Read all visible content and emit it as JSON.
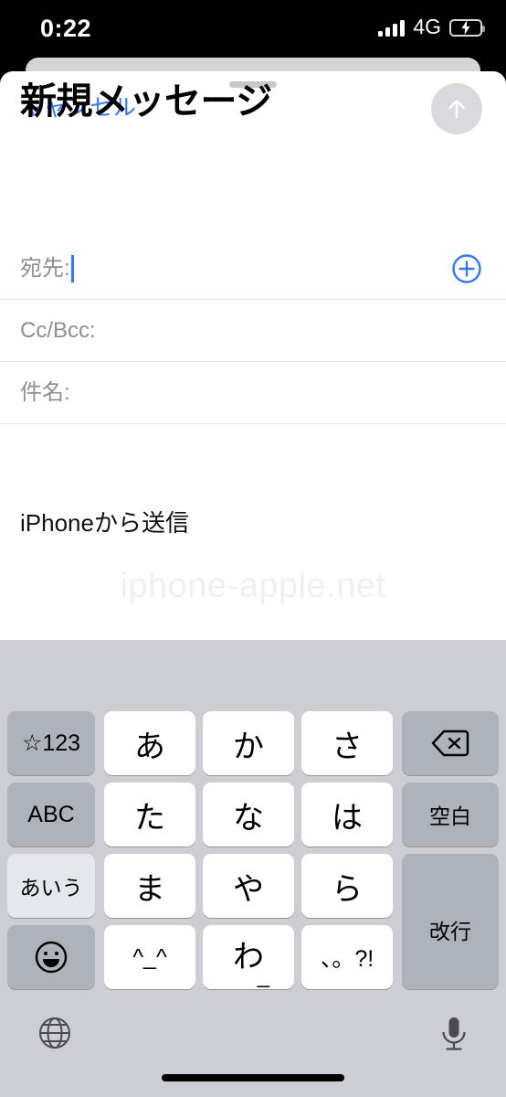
{
  "status_bar": {
    "time": "0:22",
    "network": "4G",
    "signal_icon": "signal-bars-icon",
    "signal_bars": 4,
    "battery_icon": "battery-charging-icon",
    "battery_color": "#34c759",
    "charging": "true"
  },
  "compose": {
    "cancel_label": "キャンセル",
    "title": "新規メッセージ",
    "send_icon": "arrow-up-icon",
    "send_enabled": "false",
    "add_contact_icon": "plus-circle-icon",
    "accent_color": "#3478f6",
    "fields": [
      {
        "label": "宛先:",
        "value": "",
        "focused": "true"
      },
      {
        "label": "Cc/Bcc:",
        "value": "",
        "focused": "false"
      },
      {
        "label": "件名:",
        "value": "",
        "focused": "false"
      }
    ],
    "body_text": "iPhoneから送信",
    "watermark": "iphone-apple.net"
  },
  "keyboard": {
    "type": "japanese-kana-10key",
    "rows": [
      [
        {
          "label": "☆123",
          "style": "dark",
          "size": "small",
          "name": "key-symbols"
        },
        {
          "label": "あ",
          "style": "light",
          "size": "normal",
          "name": "key-a"
        },
        {
          "label": "か",
          "style": "light",
          "size": "normal",
          "name": "key-ka"
        },
        {
          "label": "さ",
          "style": "light",
          "size": "normal",
          "name": "key-sa"
        },
        {
          "label": "",
          "style": "dark",
          "size": "normal",
          "name": "key-backspace",
          "icon": "backspace-icon"
        }
      ],
      [
        {
          "label": "ABC",
          "style": "dark",
          "size": "small",
          "name": "key-abc"
        },
        {
          "label": "た",
          "style": "light",
          "size": "normal",
          "name": "key-ta"
        },
        {
          "label": "な",
          "style": "light",
          "size": "normal",
          "name": "key-na"
        },
        {
          "label": "は",
          "style": "light",
          "size": "normal",
          "name": "key-ha"
        },
        {
          "label": "空白",
          "style": "dark",
          "size": "tiny",
          "name": "key-space"
        }
      ],
      [
        {
          "label": "あいう",
          "style": "active",
          "size": "tiny",
          "name": "key-kana-mode"
        },
        {
          "label": "ま",
          "style": "light",
          "size": "normal",
          "name": "key-ma"
        },
        {
          "label": "や",
          "style": "light",
          "size": "normal",
          "name": "key-ya"
        },
        {
          "label": "ら",
          "style": "light",
          "size": "normal",
          "name": "key-ra"
        },
        {
          "label": "改行",
          "style": "dark",
          "size": "tiny",
          "name": "key-return"
        }
      ],
      [
        {
          "label": "",
          "style": "dark",
          "size": "normal",
          "name": "key-emoji",
          "icon": "smiley-icon"
        },
        {
          "label": "^_^",
          "style": "light",
          "size": "small",
          "name": "key-kaomoji"
        },
        {
          "label": "わ",
          "style": "light",
          "size": "normal",
          "name": "key-wa",
          "sub": "_"
        },
        {
          "label": "、。?!",
          "style": "light",
          "size": "small",
          "name": "key-punctuation"
        }
      ]
    ]
  },
  "bottom_bar": {
    "globe_icon": "globe-icon",
    "mic_icon": "microphone-icon",
    "home_indicator": "home-indicator"
  }
}
